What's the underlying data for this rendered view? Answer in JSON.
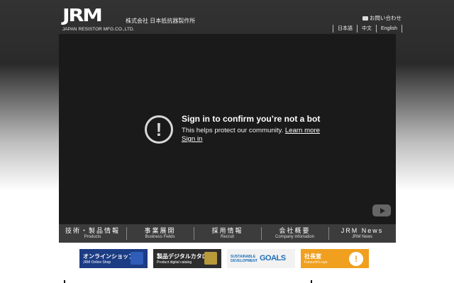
{
  "header": {
    "logo": "JRM",
    "logo_sub": "JAPAN RESISTOR MFG.CO.,LTD.",
    "company_name": "株式会社 日本抵抗器製作所",
    "contact": "お問い合わせ",
    "languages": [
      "日本語",
      "中文",
      "English"
    ]
  },
  "video": {
    "title": "Sign in to confirm you’re not a bot",
    "body": "This helps protect our community.",
    "learn_more": "Learn more",
    "sign_in": "Sign in"
  },
  "nav": [
    {
      "jp": "技術・製品情報",
      "en": "Products"
    },
    {
      "jp": "事業展開",
      "en": "Business Fields"
    },
    {
      "jp": "採用情報",
      "en": "Recruit"
    },
    {
      "jp": "会社概要",
      "en": "Company infomation"
    },
    {
      "jp": "JRM News",
      "en": "JRM News"
    }
  ],
  "banners": {
    "shop": {
      "main": "オンラインショップ",
      "sub": "JRM Online Shop"
    },
    "catalog": {
      "main": "製品デジタルカタログ",
      "sub": "Product digital catalog"
    },
    "sdgs": {
      "main1": "SUSTAINABLE",
      "main2": "DEVELOPMENT",
      "goals": "GOALS"
    },
    "president": {
      "main": "社長室",
      "sub": "Furuuchi's eye",
      "icon": "!"
    }
  }
}
